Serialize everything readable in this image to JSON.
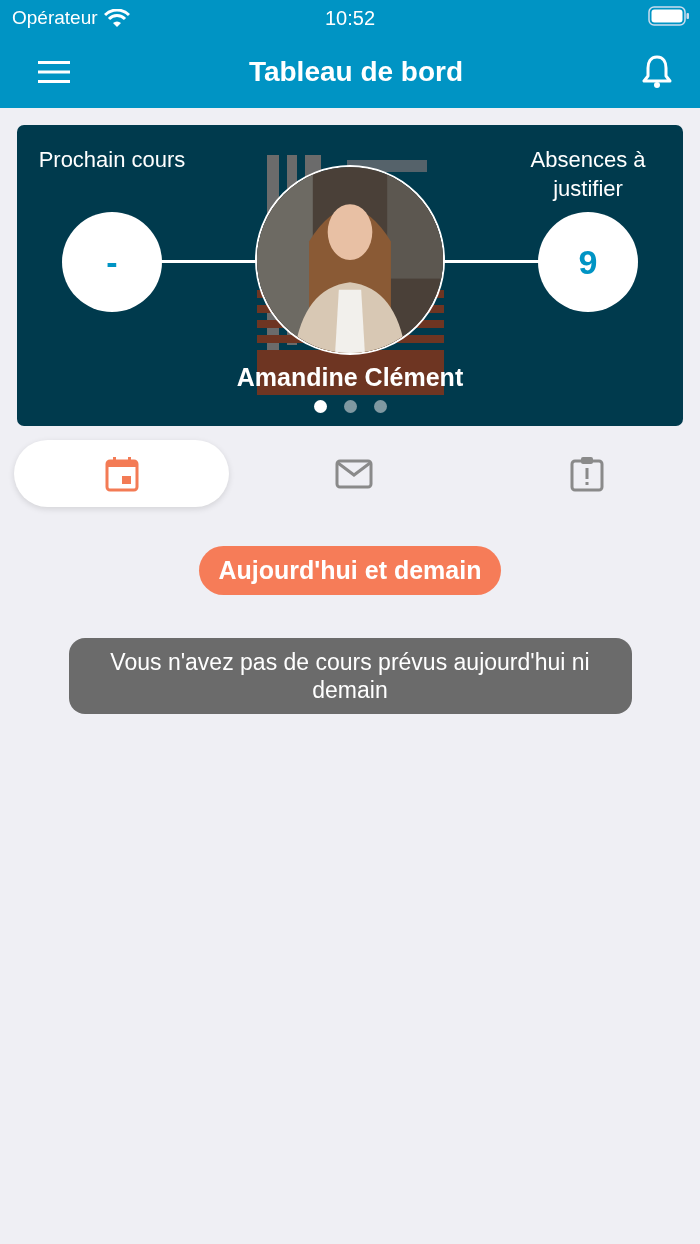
{
  "status_bar": {
    "carrier": "Opérateur",
    "time": "10:52"
  },
  "nav": {
    "title": "Tableau de bord"
  },
  "profile": {
    "name": "Amandine Clément",
    "stats": [
      {
        "label": "Prochain cours",
        "value": "-"
      },
      {
        "label": "Absences à justifier",
        "value": "9"
      }
    ],
    "pages": [
      {
        "selected": true
      },
      {
        "selected": false
      },
      {
        "selected": false
      }
    ]
  },
  "tabs": [
    {
      "kind": "calendar",
      "selected": true
    },
    {
      "kind": "mail",
      "selected": false
    },
    {
      "kind": "alert",
      "selected": false
    }
  ],
  "section_label": "Aujourd'hui et demain",
  "message": "Vous n'avez pas de cours prévus aujourd'hui ni demain"
}
